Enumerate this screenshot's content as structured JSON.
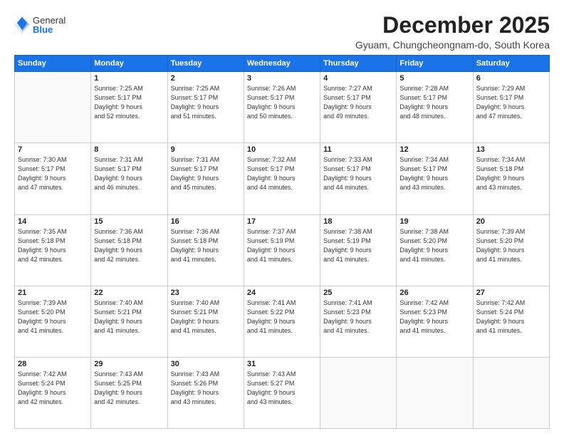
{
  "logo": {
    "general": "General",
    "blue": "Blue"
  },
  "title": "December 2025",
  "location": "Gyuam, Chungcheongnam-do, South Korea",
  "days_header": [
    "Sunday",
    "Monday",
    "Tuesday",
    "Wednesday",
    "Thursday",
    "Friday",
    "Saturday"
  ],
  "weeks": [
    [
      {
        "day": "",
        "info": ""
      },
      {
        "day": "1",
        "info": "Sunrise: 7:25 AM\nSunset: 5:17 PM\nDaylight: 9 hours\nand 52 minutes."
      },
      {
        "day": "2",
        "info": "Sunrise: 7:25 AM\nSunset: 5:17 PM\nDaylight: 9 hours\nand 51 minutes."
      },
      {
        "day": "3",
        "info": "Sunrise: 7:26 AM\nSunset: 5:17 PM\nDaylight: 9 hours\nand 50 minutes."
      },
      {
        "day": "4",
        "info": "Sunrise: 7:27 AM\nSunset: 5:17 PM\nDaylight: 9 hours\nand 49 minutes."
      },
      {
        "day": "5",
        "info": "Sunrise: 7:28 AM\nSunset: 5:17 PM\nDaylight: 9 hours\nand 48 minutes."
      },
      {
        "day": "6",
        "info": "Sunrise: 7:29 AM\nSunset: 5:17 PM\nDaylight: 9 hours\nand 47 minutes."
      }
    ],
    [
      {
        "day": "7",
        "info": "Sunrise: 7:30 AM\nSunset: 5:17 PM\nDaylight: 9 hours\nand 47 minutes."
      },
      {
        "day": "8",
        "info": "Sunrise: 7:31 AM\nSunset: 5:17 PM\nDaylight: 9 hours\nand 46 minutes."
      },
      {
        "day": "9",
        "info": "Sunrise: 7:31 AM\nSunset: 5:17 PM\nDaylight: 9 hours\nand 45 minutes."
      },
      {
        "day": "10",
        "info": "Sunrise: 7:32 AM\nSunset: 5:17 PM\nDaylight: 9 hours\nand 44 minutes."
      },
      {
        "day": "11",
        "info": "Sunrise: 7:33 AM\nSunset: 5:17 PM\nDaylight: 9 hours\nand 44 minutes."
      },
      {
        "day": "12",
        "info": "Sunrise: 7:34 AM\nSunset: 5:17 PM\nDaylight: 9 hours\nand 43 minutes."
      },
      {
        "day": "13",
        "info": "Sunrise: 7:34 AM\nSunset: 5:18 PM\nDaylight: 9 hours\nand 43 minutes."
      }
    ],
    [
      {
        "day": "14",
        "info": "Sunrise: 7:35 AM\nSunset: 5:18 PM\nDaylight: 9 hours\nand 42 minutes."
      },
      {
        "day": "15",
        "info": "Sunrise: 7:36 AM\nSunset: 5:18 PM\nDaylight: 9 hours\nand 42 minutes."
      },
      {
        "day": "16",
        "info": "Sunrise: 7:36 AM\nSunset: 5:18 PM\nDaylight: 9 hours\nand 41 minutes."
      },
      {
        "day": "17",
        "info": "Sunrise: 7:37 AM\nSunset: 5:19 PM\nDaylight: 9 hours\nand 41 minutes."
      },
      {
        "day": "18",
        "info": "Sunrise: 7:38 AM\nSunset: 5:19 PM\nDaylight: 9 hours\nand 41 minutes."
      },
      {
        "day": "19",
        "info": "Sunrise: 7:38 AM\nSunset: 5:20 PM\nDaylight: 9 hours\nand 41 minutes."
      },
      {
        "day": "20",
        "info": "Sunrise: 7:39 AM\nSunset: 5:20 PM\nDaylight: 9 hours\nand 41 minutes."
      }
    ],
    [
      {
        "day": "21",
        "info": "Sunrise: 7:39 AM\nSunset: 5:20 PM\nDaylight: 9 hours\nand 41 minutes."
      },
      {
        "day": "22",
        "info": "Sunrise: 7:40 AM\nSunset: 5:21 PM\nDaylight: 9 hours\nand 41 minutes."
      },
      {
        "day": "23",
        "info": "Sunrise: 7:40 AM\nSunset: 5:21 PM\nDaylight: 9 hours\nand 41 minutes."
      },
      {
        "day": "24",
        "info": "Sunrise: 7:41 AM\nSunset: 5:22 PM\nDaylight: 9 hours\nand 41 minutes."
      },
      {
        "day": "25",
        "info": "Sunrise: 7:41 AM\nSunset: 5:23 PM\nDaylight: 9 hours\nand 41 minutes."
      },
      {
        "day": "26",
        "info": "Sunrise: 7:42 AM\nSunset: 5:23 PM\nDaylight: 9 hours\nand 41 minutes."
      },
      {
        "day": "27",
        "info": "Sunrise: 7:42 AM\nSunset: 5:24 PM\nDaylight: 9 hours\nand 41 minutes."
      }
    ],
    [
      {
        "day": "28",
        "info": "Sunrise: 7:42 AM\nSunset: 5:24 PM\nDaylight: 9 hours\nand 42 minutes."
      },
      {
        "day": "29",
        "info": "Sunrise: 7:43 AM\nSunset: 5:25 PM\nDaylight: 9 hours\nand 42 minutes."
      },
      {
        "day": "30",
        "info": "Sunrise: 7:43 AM\nSunset: 5:26 PM\nDaylight: 9 hours\nand 43 minutes."
      },
      {
        "day": "31",
        "info": "Sunrise: 7:43 AM\nSunset: 5:27 PM\nDaylight: 9 hours\nand 43 minutes."
      },
      {
        "day": "",
        "info": ""
      },
      {
        "day": "",
        "info": ""
      },
      {
        "day": "",
        "info": ""
      }
    ]
  ]
}
